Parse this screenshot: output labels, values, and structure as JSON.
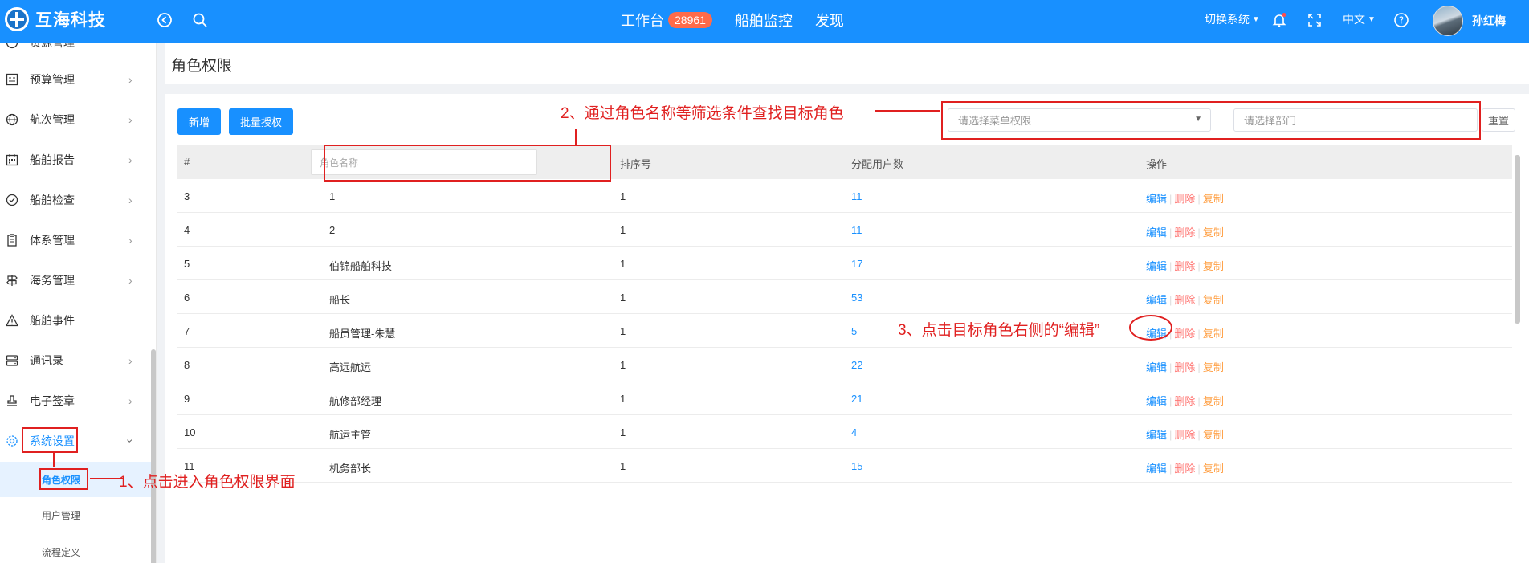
{
  "header": {
    "brand": "互海科技",
    "nav": [
      {
        "label": "工作台",
        "badge": "28961"
      },
      {
        "label": "船舶监控"
      },
      {
        "label": "发现"
      }
    ],
    "switch_system": "切换系统",
    "language": "中文",
    "username": "孙红梅"
  },
  "sidebar": {
    "partial_item": "资源管理",
    "items": [
      {
        "label": "预算管理",
        "icon": "budget-icon"
      },
      {
        "label": "航次管理",
        "icon": "globe-icon"
      },
      {
        "label": "船舶报告",
        "icon": "calendar-icon"
      },
      {
        "label": "船舶检查",
        "icon": "check-circle-icon"
      },
      {
        "label": "体系管理",
        "icon": "document-icon"
      },
      {
        "label": "海务管理",
        "icon": "signpost-icon"
      },
      {
        "label": "船舶事件",
        "icon": "warning-icon"
      },
      {
        "label": "通讯录",
        "icon": "server-icon"
      },
      {
        "label": "电子签章",
        "icon": "stamp-icon"
      },
      {
        "label": "系统设置",
        "icon": "gear-icon"
      }
    ],
    "sub_items": [
      {
        "label": "角色权限",
        "active": true
      },
      {
        "label": "用户管理"
      },
      {
        "label": "流程定义"
      }
    ]
  },
  "page": {
    "title": "角色权限"
  },
  "toolbar": {
    "add_label": "新增",
    "batch_label": "批量授权",
    "menu_select_placeholder": "请选择菜单权限",
    "dept_select_placeholder": "请选择部门",
    "reset_label": "重置"
  },
  "table": {
    "headers": {
      "index": "#",
      "name_placeholder": "角色名称",
      "sort": "排序号",
      "users": "分配用户数",
      "ops": "操作"
    },
    "ops": {
      "edit": "编辑",
      "delete": "删除",
      "copy": "复制"
    },
    "rows": [
      {
        "index": "3",
        "name": "1",
        "sort": "1",
        "users": "11"
      },
      {
        "index": "4",
        "name": "2",
        "sort": "1",
        "users": "11"
      },
      {
        "index": "5",
        "name": "伯锦船舶科技",
        "sort": "1",
        "users": "17"
      },
      {
        "index": "6",
        "name": "船长",
        "sort": "1",
        "users": "53"
      },
      {
        "index": "7",
        "name": "船员管理-朱慧",
        "sort": "1",
        "users": "5"
      },
      {
        "index": "8",
        "name": "高远航运",
        "sort": "1",
        "users": "22"
      },
      {
        "index": "9",
        "name": "航修部经理",
        "sort": "1",
        "users": "21"
      },
      {
        "index": "10",
        "name": "航运主管",
        "sort": "1",
        "users": "4"
      },
      {
        "index": "11",
        "name": "机务部长",
        "sort": "1",
        "users": "15"
      }
    ]
  },
  "annotations": {
    "step1": "1、点击进入角色权限界面",
    "step2": "2、通过角色名称等筛选条件查找目标角色",
    "step3": "3、点击目标角色右侧的“编辑”"
  },
  "colors": {
    "primary": "#1890ff",
    "danger": "#ff7875",
    "warning": "#ff9f43",
    "annotation": "#e02020"
  }
}
